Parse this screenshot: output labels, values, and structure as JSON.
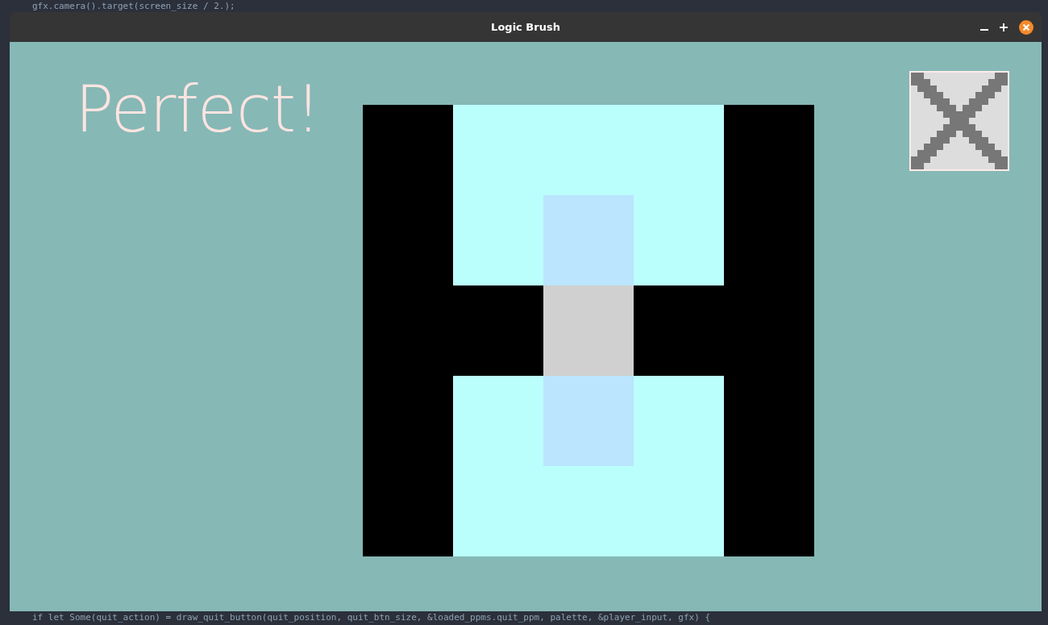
{
  "background_code": {
    "top_line": "gfx.camera().target(screen_size / 2.);",
    "bottom_line": "if let Some(quit_action) = draw_quit_button(quit_position, quit_btn_size, &loaded_ppms.quit_ppm, palette, &player_input, gfx) {"
  },
  "window": {
    "title": "Logic Brush"
  },
  "status_text": "Perfect!",
  "puzzle": {
    "rows": [
      {
        "cells": [
          {
            "color": "#000000"
          },
          {
            "color": "#bbfffc"
          },
          {
            "color": "#bbfffc"
          },
          {
            "color": "#bbfffc"
          },
          {
            "color": "#000000"
          }
        ]
      },
      {
        "cells": [
          {
            "color": "#000000"
          },
          {
            "color": "#bbfffc"
          },
          {
            "color": "#bbe5fe"
          },
          {
            "color": "#bbfffc"
          },
          {
            "color": "#000000"
          }
        ]
      },
      {
        "cells": [
          {
            "color": "#000000"
          },
          {
            "color": "#000000"
          },
          {
            "color": "#d0d0d0"
          },
          {
            "color": "#000000"
          },
          {
            "color": "#000000"
          }
        ]
      },
      {
        "cells": [
          {
            "color": "#000000"
          },
          {
            "color": "#bbfffc"
          },
          {
            "color": "#bbe5fe"
          },
          {
            "color": "#bbfffc"
          },
          {
            "color": "#000000"
          }
        ]
      },
      {
        "cells": [
          {
            "color": "#000000"
          },
          {
            "color": "#bbfffc"
          },
          {
            "color": "#bbfffc"
          },
          {
            "color": "#bbfffc"
          },
          {
            "color": "#000000"
          }
        ]
      }
    ]
  }
}
